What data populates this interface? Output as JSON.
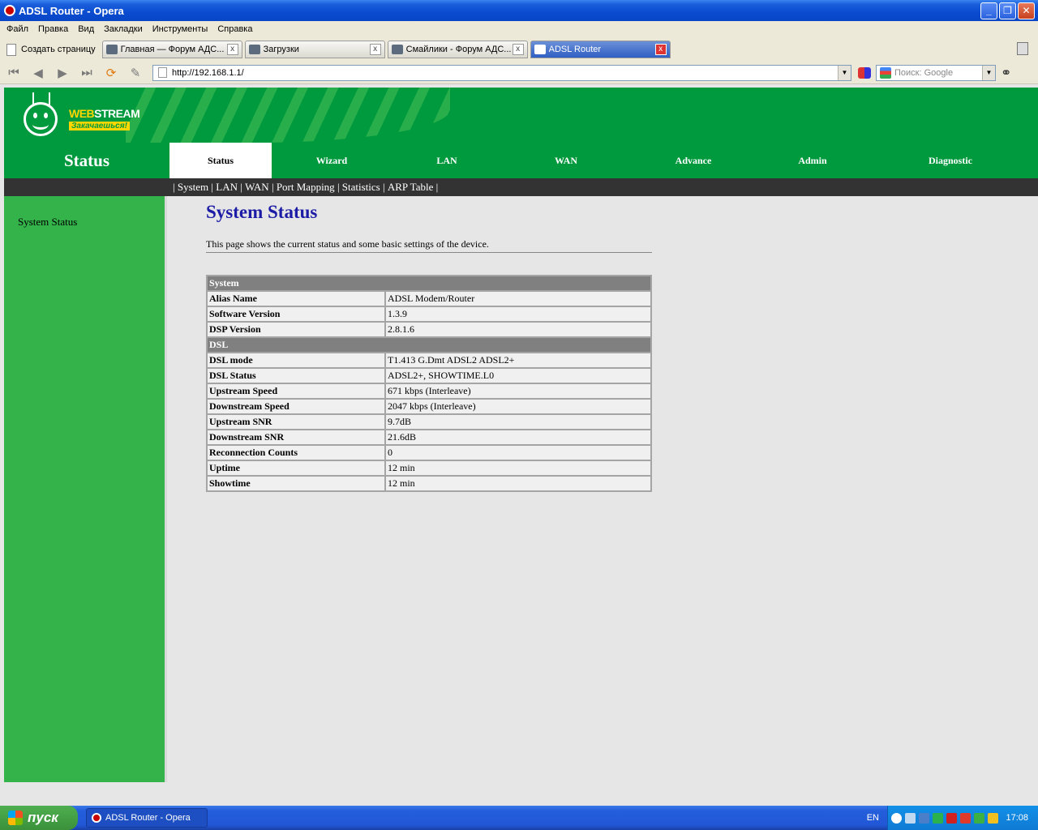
{
  "window": {
    "title": "ADSL Router - Opera",
    "minimize": "_",
    "maximize": "❐",
    "close": "✕"
  },
  "menu": [
    "Файл",
    "Правка",
    "Вид",
    "Закладки",
    "Инструменты",
    "Справка"
  ],
  "tabbar": {
    "new_page_label": "Создать страницу",
    "tabs": [
      {
        "label": "Главная — Форум АДС...",
        "active": false
      },
      {
        "label": "Загрузки",
        "active": false
      },
      {
        "label": "Смайлики - Форум АДС...",
        "active": false
      },
      {
        "label": "ADSL Router",
        "active": true
      }
    ],
    "close_glyph": "x"
  },
  "addressbar": {
    "url": "http://192.168.1.1/",
    "search_placeholder": "Поиск: Google"
  },
  "page": {
    "brand_web": "WEB",
    "brand_stream": "STREAM",
    "slogan": "Закачаешься!",
    "section_title": "Status",
    "nav": [
      {
        "label": "Status",
        "active": true
      },
      {
        "label": "Wizard",
        "active": false
      },
      {
        "label": "LAN",
        "active": false
      },
      {
        "label": "WAN",
        "active": false
      },
      {
        "label": "Advance",
        "active": false
      },
      {
        "label": "Admin",
        "active": false
      },
      {
        "label": "Diagnostic",
        "active": false
      }
    ],
    "subnav": [
      "System",
      "LAN",
      "WAN",
      "Port Mapping",
      "Statistics",
      "ARP Table"
    ],
    "sidebar_item": "System Status",
    "heading": "System Status",
    "description": "This page shows the current status and some basic settings of the device.",
    "table": [
      {
        "section": "System"
      },
      {
        "key": "Alias Name",
        "value": "ADSL Modem/Router"
      },
      {
        "key": "Software Version",
        "value": "1.3.9"
      },
      {
        "key": "DSP Version",
        "value": "2.8.1.6"
      },
      {
        "section": "DSL"
      },
      {
        "key": "DSL mode",
        "value": "T1.413 G.Dmt ADSL2 ADSL2+"
      },
      {
        "key": "DSL Status",
        "value": "ADSL2+, SHOWTIME.L0"
      },
      {
        "key": "Upstream Speed",
        "value": "671 kbps  (Interleave)"
      },
      {
        "key": "Downstream Speed",
        "value": "2047 kbps  (Interleave)"
      },
      {
        "key": "Upstream SNR",
        "value": "9.7dB"
      },
      {
        "key": "Downstream SNR",
        "value": "21.6dB"
      },
      {
        "key": "Reconnection Counts",
        "value": "0"
      },
      {
        "key": "Uptime",
        "value": "12 min"
      },
      {
        "key": "Showtime",
        "value": "12 min"
      }
    ]
  },
  "taskbar": {
    "start": "пуск",
    "task": "ADSL Router - Opera",
    "lang": "EN",
    "clock": "17:08"
  },
  "colors": {
    "brand_green": "#009a3e",
    "sidebar_green": "#33b34a",
    "heading_blue": "#1c1ca6",
    "subnav_dark": "#333333"
  }
}
